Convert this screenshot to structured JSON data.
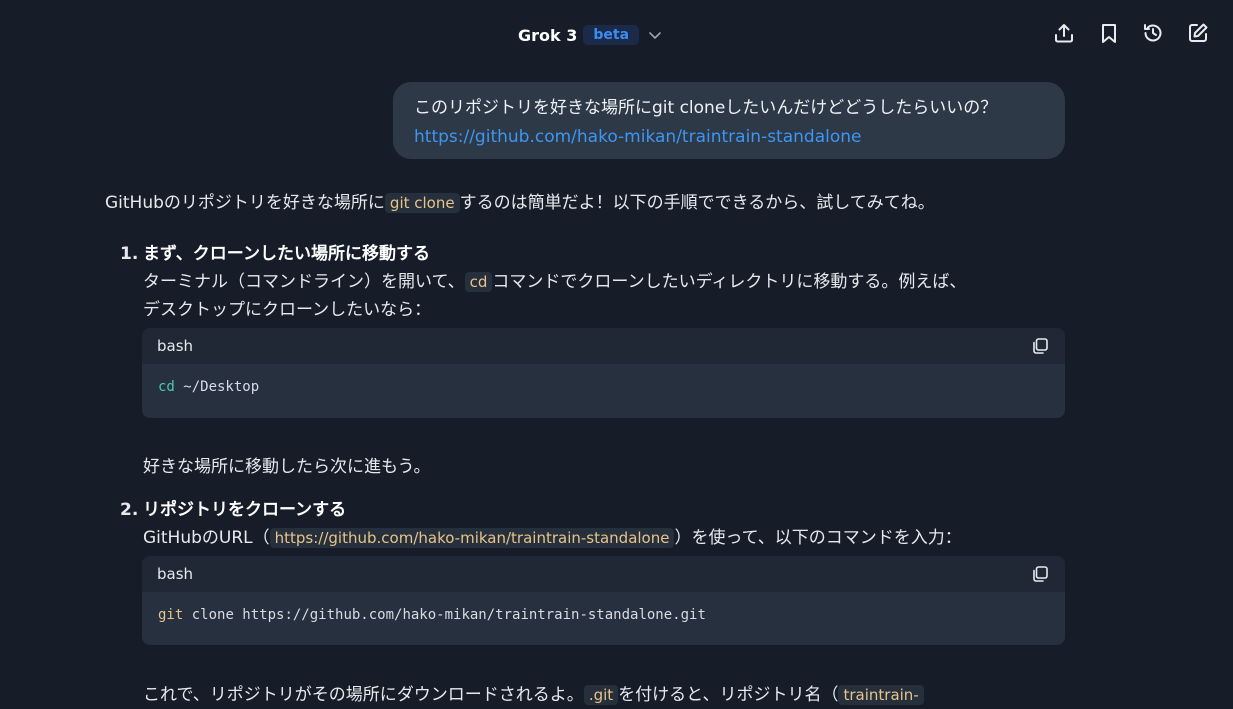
{
  "header": {
    "model_name": "Grok 3",
    "badge": "beta",
    "icons": [
      "share-icon",
      "bookmark-icon",
      "history-icon",
      "edit-icon"
    ]
  },
  "user_message": {
    "text": "このリポジトリを好きな場所にgit cloneしたいんだけどどうしたらいいの？",
    "link": "https://github.com/hako-mikan/traintrain-standalone"
  },
  "answer": {
    "intro_before": "GitHubのリポジトリを好きな場所に",
    "intro_code": "git clone",
    "intro_after": "するのは簡単だよ！以下の手順でできるから、試してみてね。",
    "step1": {
      "number": "1.",
      "title": "まず、クローンしたい場所に移動する",
      "text_before": "ターミナル（コマンドライン）を開いて、",
      "code": "cd",
      "text_after_line1": "コマンドでクローンしたいディレクトリに移動する。例えば、",
      "text_line2": "デスクトップにクローンしたいなら：",
      "codeblock": {
        "lang": "bash",
        "cmd": "cd",
        "args": " ~/Desktop"
      },
      "after": "好きな場所に移動したら次に進もう。"
    },
    "step2": {
      "number": "2.",
      "title": "リポジトリをクローンする",
      "text_before": "GitHubのURL（",
      "code_url": "https://github.com/hako-mikan/traintrain-standalone",
      "text_after": "）を使って、以下のコマンドを入力：",
      "codeblock": {
        "lang": "bash",
        "cmd": "git",
        "args": " clone https://github.com/hako-mikan/traintrain-standalone.git"
      },
      "after_before": "これで、リポジトリがその場所にダウンロードされるよ。",
      "after_code": ".git",
      "after_middle": "を付けると、リポジトリ名（",
      "after_code2": "traintrain-"
    }
  },
  "colors": {
    "background": "#161d28",
    "bubble": "#2e3947",
    "link": "#3d96f2",
    "badge_text": "#3b8cf0",
    "inline_code": "#e7c48a"
  }
}
